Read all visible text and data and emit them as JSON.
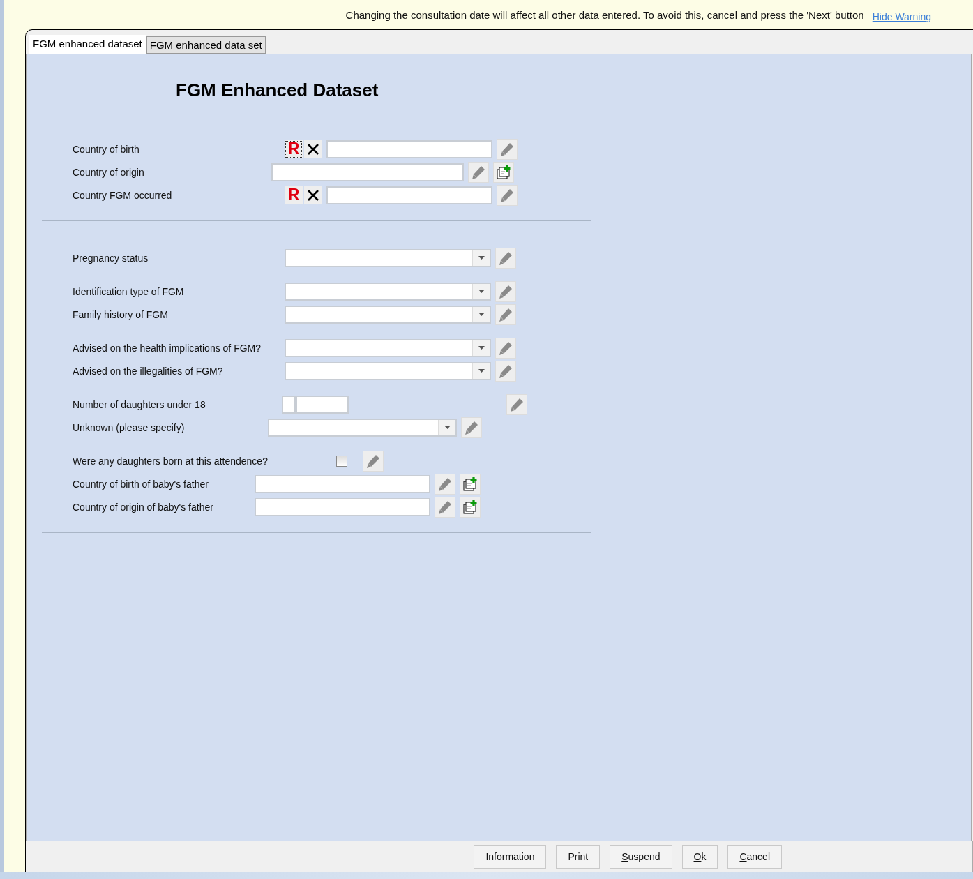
{
  "warning": {
    "text": "Changing the consultation date will affect all other data entered. To avoid this, cancel and press the 'Next' button",
    "link": "Hide Warning"
  },
  "tabs": [
    {
      "label": "FGM enhanced dataset",
      "selected": true
    },
    {
      "label": "FGM enhanced data set",
      "selected": false
    }
  ],
  "form": {
    "title": "FGM Enhanced Dataset",
    "sections": [
      {
        "groups": [
          [
            {
              "label": "Country of birth",
              "kind": "text",
              "required_mark": "R",
              "focused_mark": true,
              "add_button": false
            },
            {
              "label": "Country of origin",
              "kind": "text",
              "add_button": true
            },
            {
              "label": "Country FGM occurred",
              "kind": "text",
              "required_mark": "R",
              "focused_mark": false,
              "add_button": false
            }
          ]
        ]
      },
      {
        "groups": [
          [
            {
              "label": "Pregnancy status",
              "kind": "select"
            }
          ],
          [
            {
              "label": "Identification type of FGM",
              "kind": "select"
            },
            {
              "label": "Family history of FGM",
              "kind": "select"
            }
          ],
          [
            {
              "label": "Advised on the health implications of FGM?",
              "kind": "select"
            },
            {
              "label": "Advised on the illegalities of FGM?",
              "kind": "select"
            }
          ],
          [
            {
              "label": "Number of daughters under 18",
              "kind": "number"
            },
            {
              "label": "Unknown (please specify)",
              "kind": "select"
            }
          ],
          [
            {
              "label": "Were any daughters born at this attendence?",
              "kind": "checkbox",
              "checked": false
            },
            {
              "label": "Country of birth of baby's father",
              "kind": "text",
              "add_button": true
            },
            {
              "label": "Country of origin of baby's father",
              "kind": "text",
              "add_button": true
            }
          ]
        ]
      }
    ]
  },
  "buttons": [
    {
      "label": "Information",
      "mnemonic": false
    },
    {
      "label": "Print",
      "mnemonic": false
    },
    {
      "label": "Suspend",
      "mnemonic": true
    },
    {
      "label": "Ok",
      "mnemonic": true
    },
    {
      "label": "Cancel",
      "mnemonic": true
    }
  ]
}
